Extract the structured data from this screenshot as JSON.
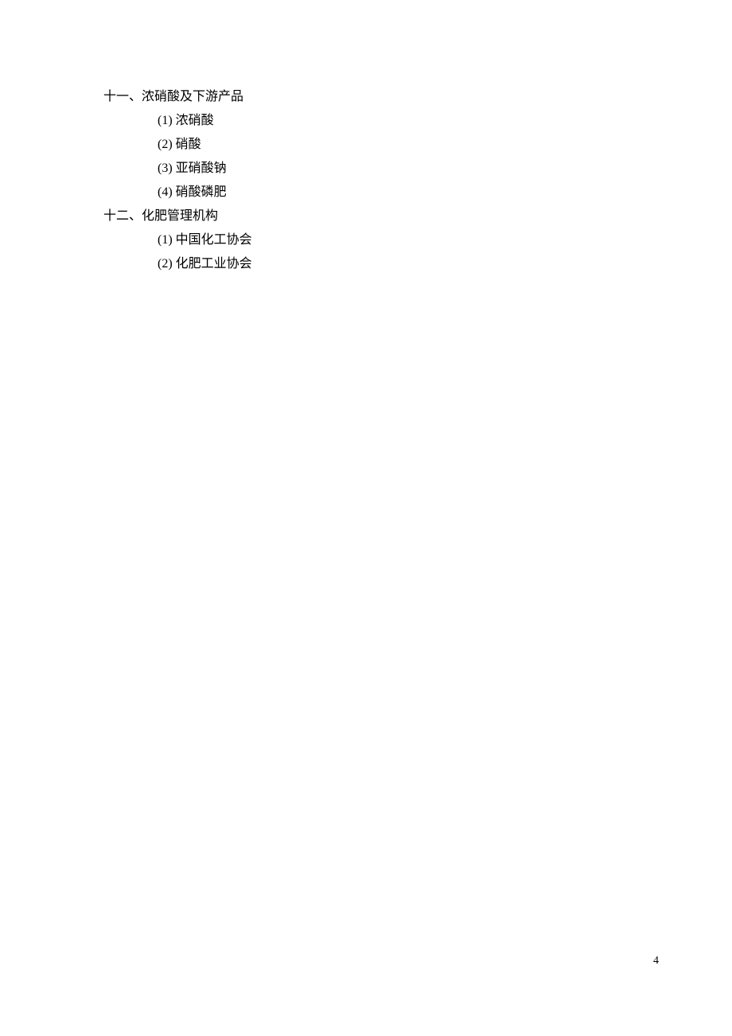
{
  "sections": [
    {
      "heading": "十一、浓硝酸及下游产品",
      "items": [
        {
          "marker": "(1)",
          "text": "浓硝酸"
        },
        {
          "marker": "(2)",
          "text": "硝酸"
        },
        {
          "marker": "(3)",
          "text": "亚硝酸钠"
        },
        {
          "marker": "(4)",
          "text": "硝酸磷肥"
        }
      ]
    },
    {
      "heading": "十二、化肥管理机构",
      "items": [
        {
          "marker": "(1)",
          "text": "中国化工协会"
        },
        {
          "marker": "(2)",
          "text": "化肥工业协会"
        }
      ]
    }
  ],
  "page_number": "4"
}
